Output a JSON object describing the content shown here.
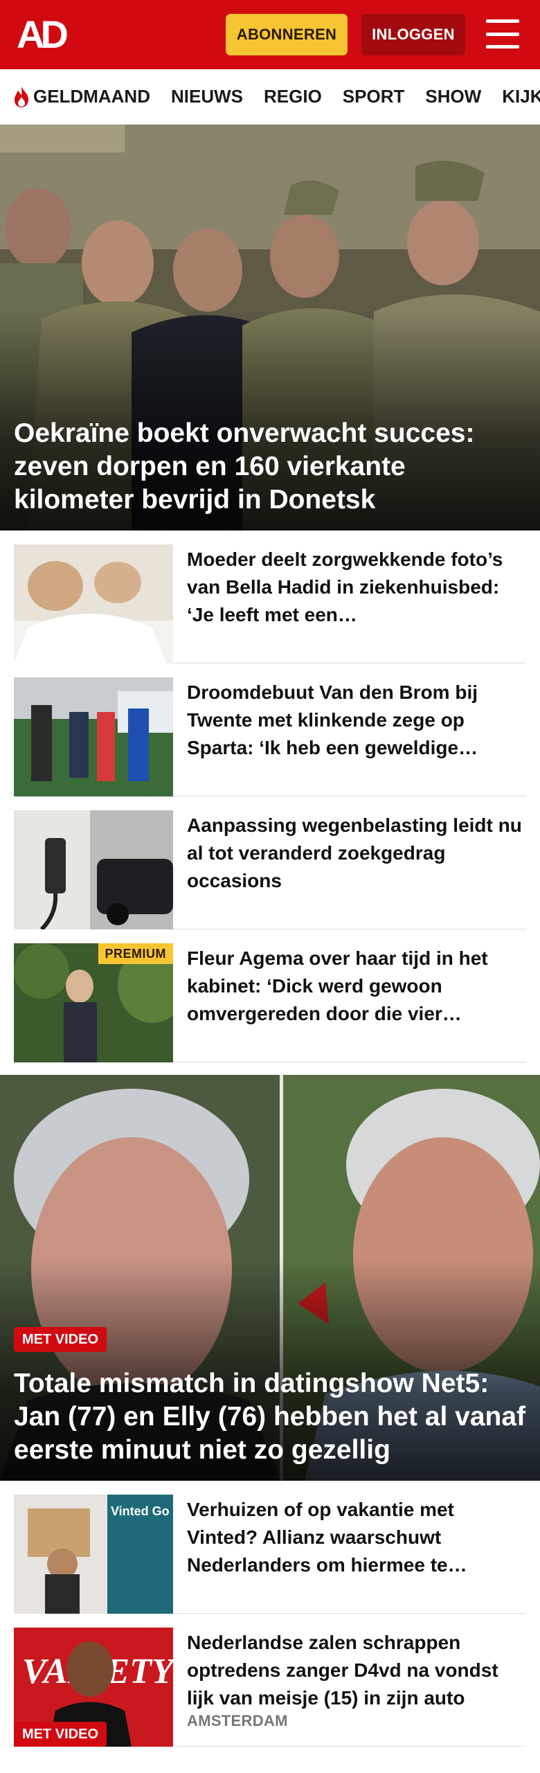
{
  "header": {
    "logo": "AD",
    "subscribe_label": "ABONNEREN",
    "login_label": "INLOGGEN",
    "brand_color": "#d10a11",
    "subscribe_color": "#f7c531"
  },
  "nav": {
    "items": [
      {
        "label": "GELDMAAND",
        "icon": "flame-icon"
      },
      {
        "label": "NIEUWS"
      },
      {
        "label": "REGIO"
      },
      {
        "label": "SPORT"
      },
      {
        "label": "SHOW"
      },
      {
        "label": "KIJK"
      }
    ]
  },
  "hero1": {
    "title": "Oekraïne boekt onverwacht succes: zeven dorpen en 160 vierkante kilometer bevrijd in Donetsk"
  },
  "articles1": [
    {
      "title": "Moeder deelt zorgwekkende foto’s van Bella Hadid in ziekenhuisbed: ‘Je leeft met een…"
    },
    {
      "title": "Droomdebuut Van den Brom bij Twente met klinkende zege op Sparta: ‘Ik heb een geweldige…"
    },
    {
      "title": "Aanpassing wegenbelasting leidt nu al tot veranderd zoekgedrag occasions"
    },
    {
      "title": "Fleur Agema over haar tijd in het kabinet: ‘Dick werd gewoon omvergereden door die vier…",
      "badge": "PREMIUM"
    }
  ],
  "hero2": {
    "badge": "MET VIDEO",
    "title": "Totale mismatch in datingshow Net5: Jan (77) en Elly (76) hebben het al vanaf eerste minuut niet zo gezellig"
  },
  "articles2": [
    {
      "title": "Verhuizen of op vakantie met Vinted? Allianz waarschuwt Nederlanders om hiermee te…",
      "thumb_text": "Vinted Go"
    },
    {
      "title": "Nederlandse zalen schrappen optredens zanger D4vd na vondst lijk van meisje (15) in zijn auto",
      "subtitle": "AMSTERDAM",
      "badge": "MET VIDEO",
      "thumb_text": "VARIETY"
    }
  ]
}
